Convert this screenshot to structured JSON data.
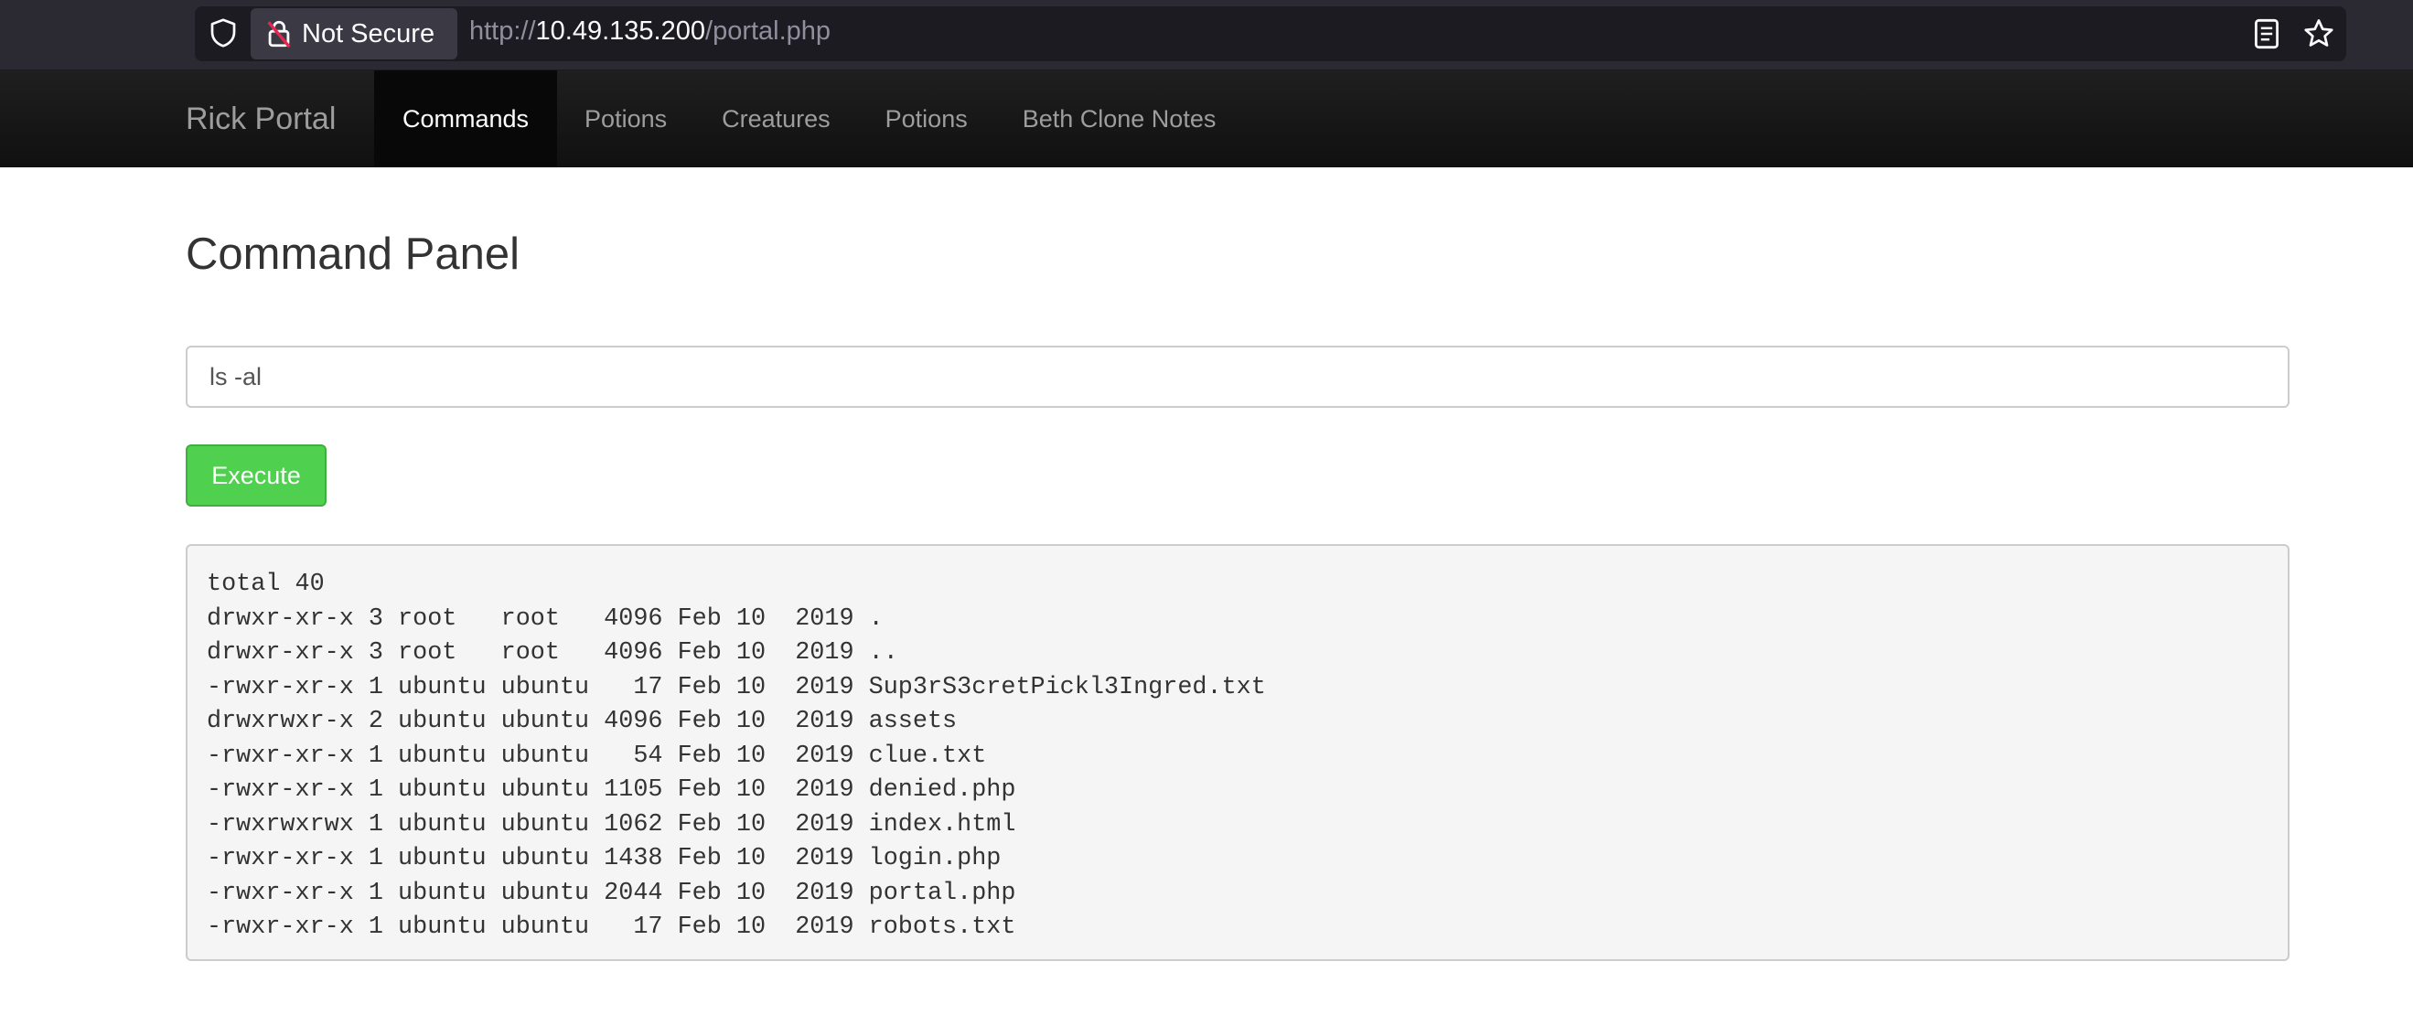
{
  "browser": {
    "security_label": "Not Secure",
    "url_scheme": "http://",
    "url_host": "10.49.135.200",
    "url_path": "/portal.php"
  },
  "navbar": {
    "brand": "Rick Portal",
    "items": [
      {
        "label": "Commands",
        "active": true
      },
      {
        "label": "Potions",
        "active": false
      },
      {
        "label": "Creatures",
        "active": false
      },
      {
        "label": "Potions",
        "active": false
      },
      {
        "label": "Beth Clone Notes",
        "active": false
      }
    ]
  },
  "panel": {
    "title": "Command Panel",
    "command_value": "ls -al",
    "execute_label": "Execute"
  },
  "output": {
    "lines": [
      "total 40",
      "drwxr-xr-x 3 root   root   4096 Feb 10  2019 .",
      "drwxr-xr-x 3 root   root   4096 Feb 10  2019 ..",
      "-rwxr-xr-x 1 ubuntu ubuntu   17 Feb 10  2019 Sup3rS3cretPickl3Ingred.txt",
      "drwxrwxr-x 2 ubuntu ubuntu 4096 Feb 10  2019 assets",
      "-rwxr-xr-x 1 ubuntu ubuntu   54 Feb 10  2019 clue.txt",
      "-rwxr-xr-x 1 ubuntu ubuntu 1105 Feb 10  2019 denied.php",
      "-rwxrwxrwx 1 ubuntu ubuntu 1062 Feb 10  2019 index.html",
      "-rwxr-xr-x 1 ubuntu ubuntu 1438 Feb 10  2019 login.php",
      "-rwxr-xr-x 1 ubuntu ubuntu 2044 Feb 10  2019 portal.php",
      "-rwxr-xr-x 1 ubuntu ubuntu   17 Feb 10  2019 robots.txt"
    ]
  },
  "icons": {
    "shield": "shield-icon",
    "lock": "lock-slash-icon",
    "reader": "reader-view-icon",
    "star": "bookmark-star-icon"
  },
  "colors": {
    "execute_button": "#4fd14f",
    "navbar_bg": "#222222",
    "navbar_active_bg": "#080808",
    "browser_bg": "#2b2a33"
  }
}
